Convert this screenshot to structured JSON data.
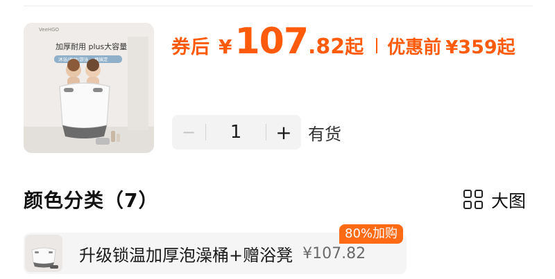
{
  "product": {
    "image_brand_text": "VeeHGO",
    "image_headline": "加厚耐用 plus大容量",
    "image_sub": "沐浴/收纳/游泳 一桶搞定",
    "price": {
      "prefix": "券后",
      "currency": "¥",
      "integer": "107",
      "decimal": ".82",
      "suffix": "起",
      "original_label": "优惠前",
      "original_currency": "¥",
      "original_value": "359",
      "original_suffix": "起"
    },
    "stepper": {
      "minus": "−",
      "quantity": "1",
      "plus": "+"
    },
    "stock": "有货"
  },
  "variants": {
    "title": "颜色分类（7）",
    "big_view_label": "大图",
    "items": [
      {
        "name": "升级锁温加厚泡澡桶+赠浴凳",
        "price": "¥107.82",
        "badge": "80%加购"
      }
    ]
  },
  "colors": {
    "accent": "#ff5b0a",
    "badge": "#ff6a14",
    "card_bg": "#f5f5f5"
  },
  "icons": {
    "big_view": "grid-icon"
  }
}
